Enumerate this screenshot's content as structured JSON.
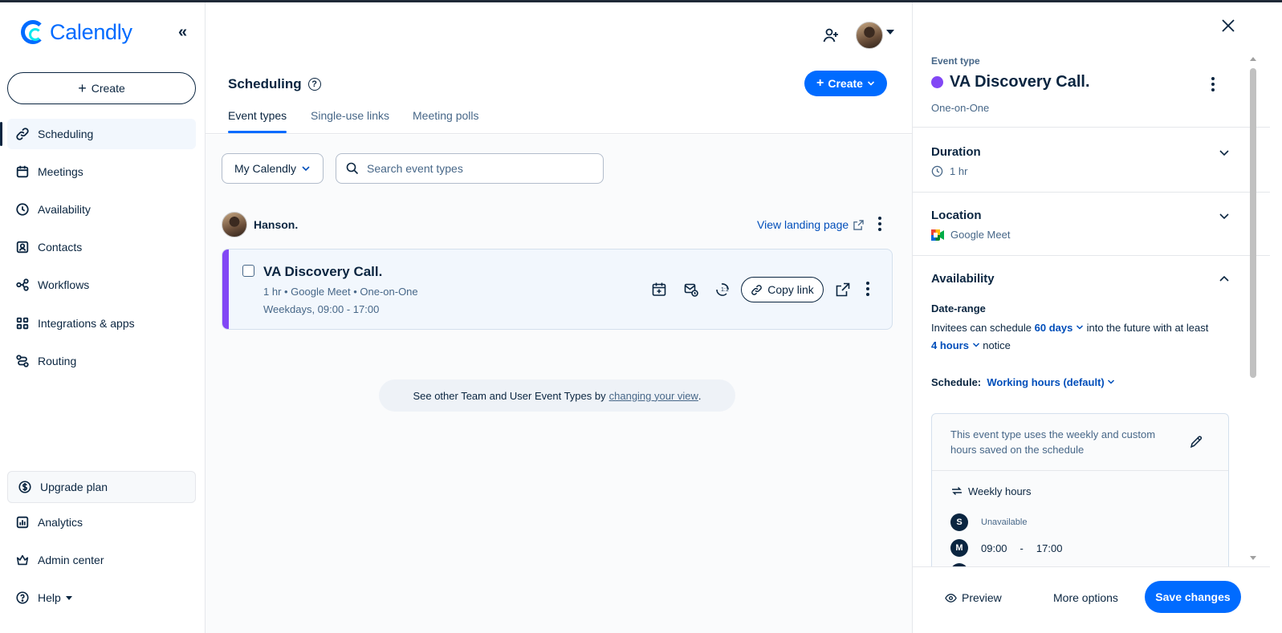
{
  "app": {
    "name": "Calendly"
  },
  "sidebar": {
    "create_label": "Create",
    "items": [
      {
        "label": "Scheduling",
        "icon": "link-icon",
        "active": true
      },
      {
        "label": "Meetings",
        "icon": "calendar-icon"
      },
      {
        "label": "Availability",
        "icon": "clock-icon"
      },
      {
        "label": "Contacts",
        "icon": "contact-card-icon"
      },
      {
        "label": "Workflows",
        "icon": "workflow-icon"
      },
      {
        "label": "Integrations & apps",
        "icon": "grid-icon"
      },
      {
        "label": "Routing",
        "icon": "routing-icon"
      }
    ],
    "upgrade_label": "Upgrade plan",
    "bottom_items": [
      {
        "label": "Analytics",
        "icon": "chart-icon"
      },
      {
        "label": "Admin center",
        "icon": "crown-icon"
      },
      {
        "label": "Help",
        "icon": "help-icon"
      }
    ]
  },
  "main": {
    "title": "Scheduling",
    "create_label": "Create",
    "tabs": [
      {
        "label": "Event types",
        "active": true
      },
      {
        "label": "Single-use links"
      },
      {
        "label": "Meeting polls"
      }
    ],
    "filter_label": "My Calendly",
    "search_placeholder": "Search event types",
    "owner_name": "Hanson.",
    "landing_link": "View landing page",
    "event": {
      "title": "VA Discovery Call.",
      "meta": "1 hr • Google Meet • One-on-One",
      "hours": "Weekdays, 09:00 - 17:00",
      "copy_link_label": "Copy link",
      "color": "#8247f5"
    },
    "team_note": {
      "text": "See other Team and User Event Types by",
      "link": "changing your view",
      "suffix": "."
    }
  },
  "panel": {
    "label": "Event type",
    "event_name": "VA Discovery Call.",
    "event_kind": "One-on-One",
    "duration": {
      "title": "Duration",
      "value": "1 hr"
    },
    "location": {
      "title": "Location",
      "value": "Google Meet"
    },
    "availability": {
      "title": "Availability",
      "date_range_label": "Date-range",
      "text_1": "Invitees can schedule",
      "days_value": "60 days",
      "text_2": "into the future with at least",
      "hours_value": "4 hours",
      "text_3": "notice",
      "schedule_label": "Schedule:",
      "schedule_value": "Working hours (default)",
      "info": "This event type uses the weekly and custom hours saved on the schedule",
      "weekly_label": "Weekly hours",
      "days": [
        {
          "day": "S",
          "unavailable": "Unavailable"
        },
        {
          "day": "M",
          "start": "09:00",
          "sep": "-",
          "end": "17:00"
        }
      ]
    },
    "footer": {
      "preview_label": "Preview",
      "more_label": "More options",
      "save_label": "Save changes"
    }
  },
  "colors": {
    "primary": "#006bff",
    "text": "#0a2540",
    "muted": "#476788",
    "event_purple": "#8247f5"
  }
}
